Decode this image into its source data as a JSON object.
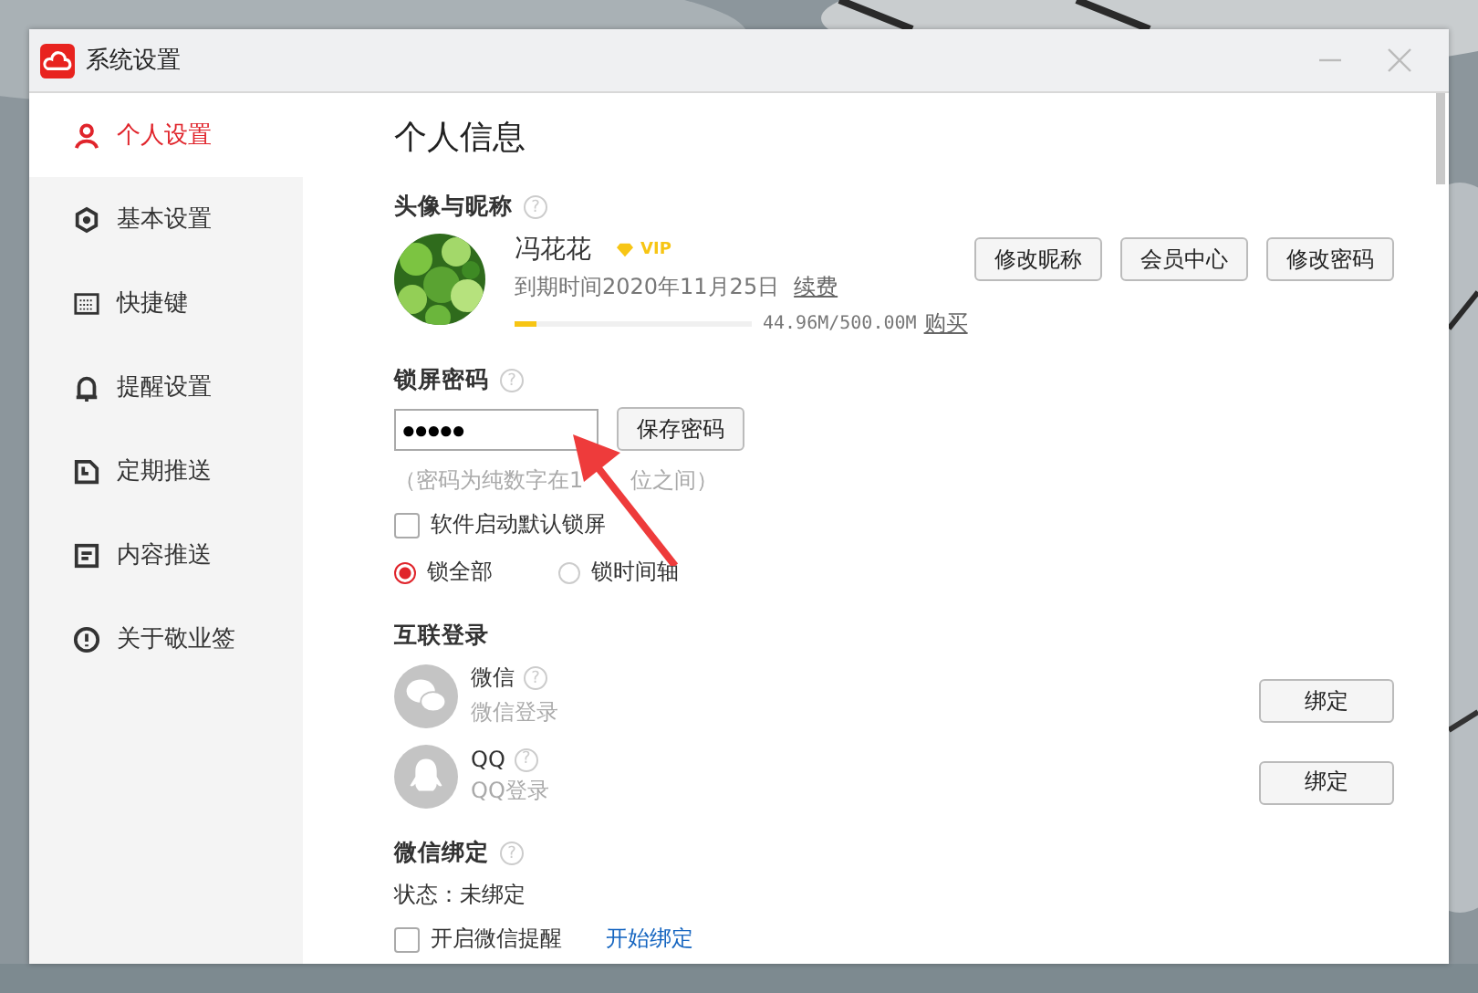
{
  "window": {
    "title": "系统设置"
  },
  "sidebar": {
    "items": [
      {
        "label": "个人设置",
        "kind": "user",
        "selected": true
      },
      {
        "label": "基本设置",
        "kind": "gear",
        "selected": false
      },
      {
        "label": "快捷键",
        "kind": "keyboard",
        "selected": false
      },
      {
        "label": "提醒设置",
        "kind": "bell",
        "selected": false
      },
      {
        "label": "定期推送",
        "kind": "clock",
        "selected": false
      },
      {
        "label": "内容推送",
        "kind": "doc",
        "selected": false
      },
      {
        "label": "关于敬业签",
        "kind": "info",
        "selected": false
      }
    ]
  },
  "page_title": "个人信息",
  "profile": {
    "heading": "头像与昵称",
    "help": "?",
    "name": "冯花花",
    "badge": "VIP",
    "expiry": "到期时间2020年11月25日",
    "renew_link": "续费",
    "level": 0.09,
    "usage": "44.96M/500.00M",
    "buy_link": "购买",
    "buttons": [
      "修改昵称",
      "会员中心",
      "修改密码"
    ]
  },
  "lock": {
    "heading": "锁屏密码",
    "help": "?",
    "password": "●●●●●",
    "save_button": "保存密码",
    "hint_start": "（密码为纯数字在1",
    "hint_end": "位之间）",
    "auto_lock": {
      "label": "软件启动默认锁屏",
      "checked": false
    },
    "options": [
      {
        "label": "锁全部",
        "selected": true
      },
      {
        "label": "锁时间轴",
        "selected": false
      }
    ]
  },
  "social": {
    "heading": "互联登录",
    "accounts": [
      {
        "name": "微信",
        "help": "?",
        "sub": "微信登录",
        "kind": "wechat",
        "button": "绑定"
      },
      {
        "name": "QQ",
        "help": "?",
        "sub": "QQ登录",
        "kind": "qq",
        "button": "绑定"
      }
    ]
  },
  "wechat_bind": {
    "heading": "微信绑定",
    "help": "?",
    "status": "状态：未绑定",
    "reminder": {
      "label": "开启微信提醒",
      "checked": false
    },
    "link": "开始绑定"
  }
}
